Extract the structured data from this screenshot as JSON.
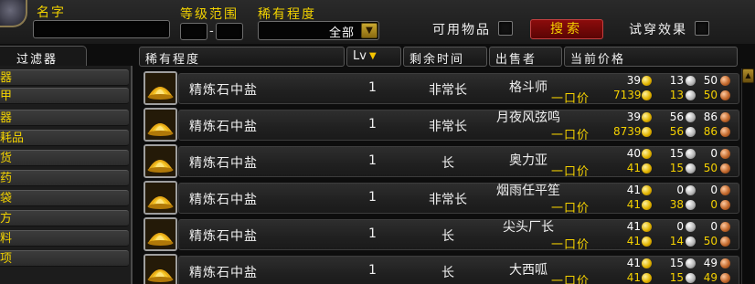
{
  "search": {
    "name_label": "名字",
    "name_value": "",
    "level_label": "等级范围",
    "level_min": "",
    "level_max": "",
    "level_dash": "-",
    "rarity_label": "稀有程度",
    "rarity_selected": "全部",
    "usable_label": "可用物品",
    "search_button": "搜索",
    "preview_label": "试穿效果"
  },
  "filter": {
    "header": "过滤器",
    "items": [
      "器",
      "甲",
      "器",
      "耗品",
      "货",
      "药",
      "袋",
      "方",
      "料",
      "项"
    ]
  },
  "columns": {
    "rarity": "稀有程度",
    "level": "Lv",
    "time_left": "剩余时间",
    "seller": "出售者",
    "current_price": "当前价格"
  },
  "buyout_label": "一口价",
  "rows": [
    {
      "name": "精炼石中盐",
      "level": "1",
      "time": "非常长",
      "seller": "格斗师",
      "bid": {
        "gold": "39",
        "silver": "13",
        "copper": "50"
      },
      "buyout": {
        "gold": "7139",
        "silver": "13",
        "copper": "50"
      }
    },
    {
      "name": "精炼石中盐",
      "level": "1",
      "time": "非常长",
      "seller": "月夜风弦鸣",
      "bid": {
        "gold": "39",
        "silver": "56",
        "copper": "86"
      },
      "buyout": {
        "gold": "8739",
        "silver": "56",
        "copper": "86"
      }
    },
    {
      "name": "精炼石中盐",
      "level": "1",
      "time": "长",
      "seller": "奥力亚",
      "bid": {
        "gold": "40",
        "silver": "15",
        "copper": "0"
      },
      "buyout": {
        "gold": "41",
        "silver": "15",
        "copper": "50"
      }
    },
    {
      "name": "精炼石中盐",
      "level": "1",
      "time": "非常长",
      "seller": "烟雨任平笙",
      "bid": {
        "gold": "41",
        "silver": "0",
        "copper": "0"
      },
      "buyout": {
        "gold": "41",
        "silver": "38",
        "copper": "0"
      }
    },
    {
      "name": "精炼石中盐",
      "level": "1",
      "time": "长",
      "seller": "尖头厂长",
      "bid": {
        "gold": "41",
        "silver": "0",
        "copper": "0"
      },
      "buyout": {
        "gold": "41",
        "silver": "14",
        "copper": "50"
      }
    },
    {
      "name": "精炼石中盐",
      "level": "1",
      "time": "长",
      "seller": "大西呱",
      "bid": {
        "gold": "41",
        "silver": "15",
        "copper": "49"
      },
      "buyout": {
        "gold": "41",
        "silver": "15",
        "copper": "49"
      }
    }
  ]
}
